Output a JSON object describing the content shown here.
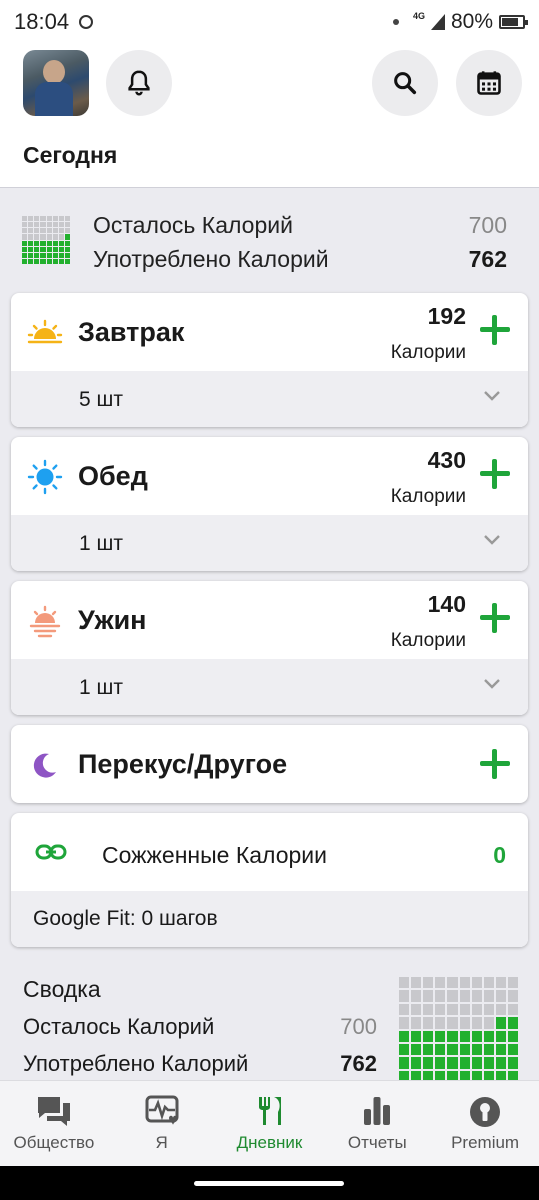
{
  "status_bar": {
    "time": "18:04",
    "network": "4G",
    "battery": "80%"
  },
  "header": {
    "title": "Сегодня"
  },
  "summary_top": {
    "remaining_label": "Осталось Калорий",
    "remaining_value": "700",
    "consumed_label": "Употреблено Калорий",
    "consumed_value": "762"
  },
  "meals": [
    {
      "name": "Завтрак",
      "calories": "192",
      "calories_label": "Калории",
      "count": "5 шт",
      "icon": "sunrise-icon"
    },
    {
      "name": "Обед",
      "calories": "430",
      "calories_label": "Калории",
      "count": "1 шт",
      "icon": "sun-icon"
    },
    {
      "name": "Ужин",
      "calories": "140",
      "calories_label": "Калории",
      "count": "1 шт",
      "icon": "sunset-icon"
    },
    {
      "name": "Перекус/Другое",
      "icon": "moon-icon"
    }
  ],
  "burned": {
    "label": "Сожженные Калории",
    "value": "0",
    "google_fit": "Google Fit: 0 шагов"
  },
  "summary_bottom": {
    "title": "Сводка",
    "remaining_label": "Осталось Калорий",
    "remaining_value": "700",
    "consumed_label": "Употреблено Калорий",
    "consumed_value": "762"
  },
  "nav": [
    {
      "label": "Общество",
      "icon": "chat-icon"
    },
    {
      "label": "Я",
      "icon": "heart-pulse-icon"
    },
    {
      "label": "Дневник",
      "icon": "fork-knife-icon",
      "active": true
    },
    {
      "label": "Отчеты",
      "icon": "bar-chart-icon"
    },
    {
      "label": "Premium",
      "icon": "keyhole-icon"
    }
  ],
  "colors": {
    "accent": "#1fa53a",
    "nav_active": "#1f8a30",
    "grid_empty": "#c8c8cc",
    "grid_filled": "#22b02e"
  }
}
